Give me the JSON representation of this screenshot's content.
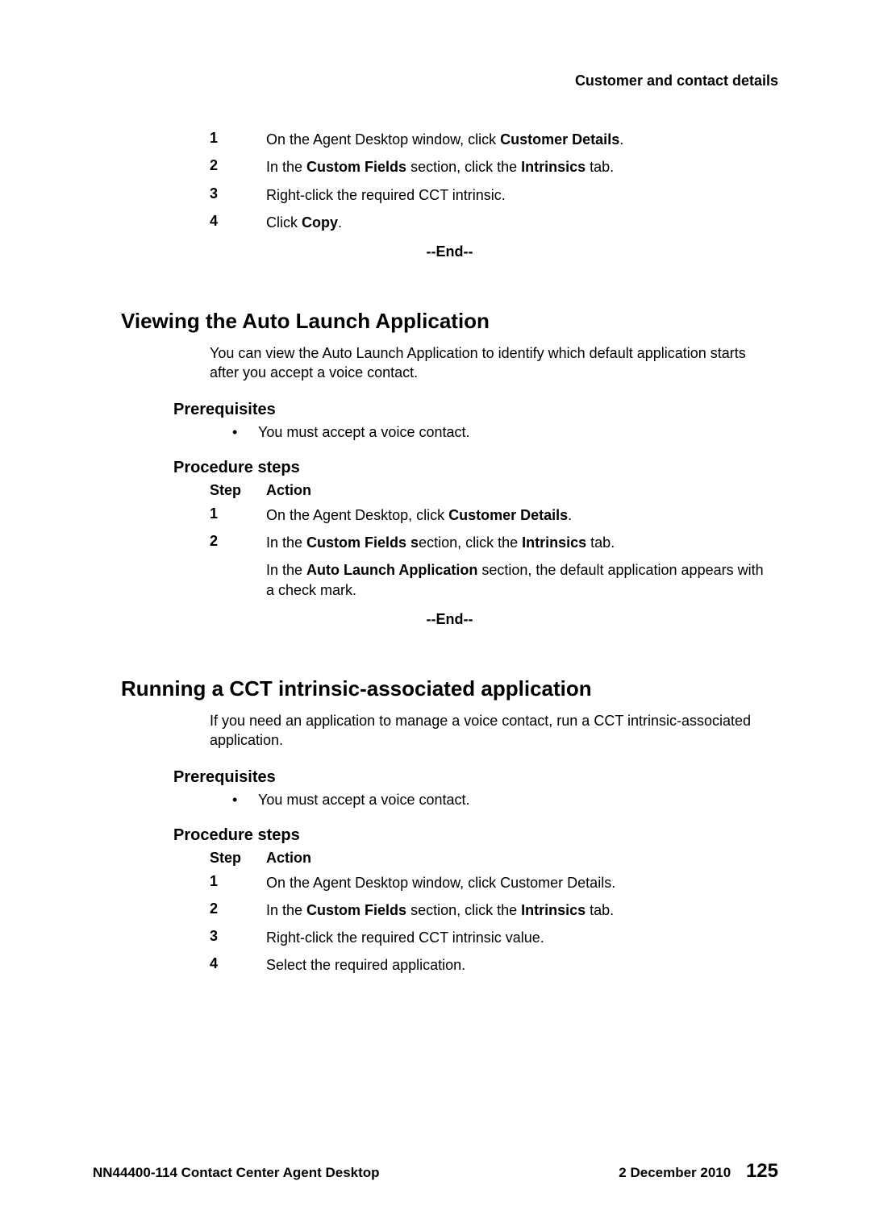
{
  "header": {
    "title": "Customer and contact details"
  },
  "procedure1": {
    "steps": [
      {
        "num": "1",
        "prefix": "On the Agent Desktop window, click ",
        "bold1": "Customer Details",
        "suffix": "."
      },
      {
        "num": "2",
        "prefix": "In the ",
        "bold1": "Custom Fields",
        "mid": " section, click the ",
        "bold2": "Intrinsics",
        "suffix": " tab."
      },
      {
        "num": "3",
        "text": "Right-click the required CCT intrinsic."
      },
      {
        "num": "4",
        "prefix": "Click ",
        "bold1": "Copy",
        "suffix": "."
      }
    ],
    "end": "--End--"
  },
  "section1": {
    "title": "Viewing the Auto Launch Application",
    "intro": "You can view the Auto Launch Application to identify which default application starts after you accept a voice contact.",
    "prereq_heading": "Prerequisites",
    "prereq_bullet": "You must accept a voice contact.",
    "proc_heading": "Procedure steps",
    "th_step": "Step",
    "th_action": "Action",
    "steps": [
      {
        "num": "1",
        "prefix": "On the Agent Desktop, click ",
        "bold1": "Customer Details",
        "suffix": "."
      },
      {
        "num": "2",
        "prefix": "In the ",
        "bold1": "Custom Fields s",
        "mid": "ection, click the ",
        "bold2": "Intrinsics",
        "suffix": " tab."
      }
    ],
    "note_prefix": "In the ",
    "note_bold": "Auto Launch Application",
    "note_suffix": " section, the default application appears with a check mark.",
    "end": "--End--"
  },
  "section2": {
    "title": "Running a CCT intrinsic-associated application",
    "intro": "If you need an application to manage a voice contact, run a CCT intrinsic-associated application.",
    "prereq_heading": "Prerequisites",
    "prereq_bullet": "You must accept a voice contact.",
    "proc_heading": "Procedure steps",
    "th_step": "Step",
    "th_action": "Action",
    "steps": [
      {
        "num": "1",
        "text": "On the Agent Desktop window, click Customer Details."
      },
      {
        "num": "2",
        "prefix": "In the ",
        "bold1": "Custom Fields",
        "mid": " section, click the ",
        "bold2": "Intrinsics",
        "suffix": " tab."
      },
      {
        "num": "3",
        "text": "Right-click the required CCT intrinsic value."
      },
      {
        "num": "4",
        "text": "Select the required application."
      }
    ]
  },
  "footer": {
    "left": "NN44400-114 Contact Center Agent Desktop",
    "date": "2 December 2010",
    "page": "125"
  }
}
